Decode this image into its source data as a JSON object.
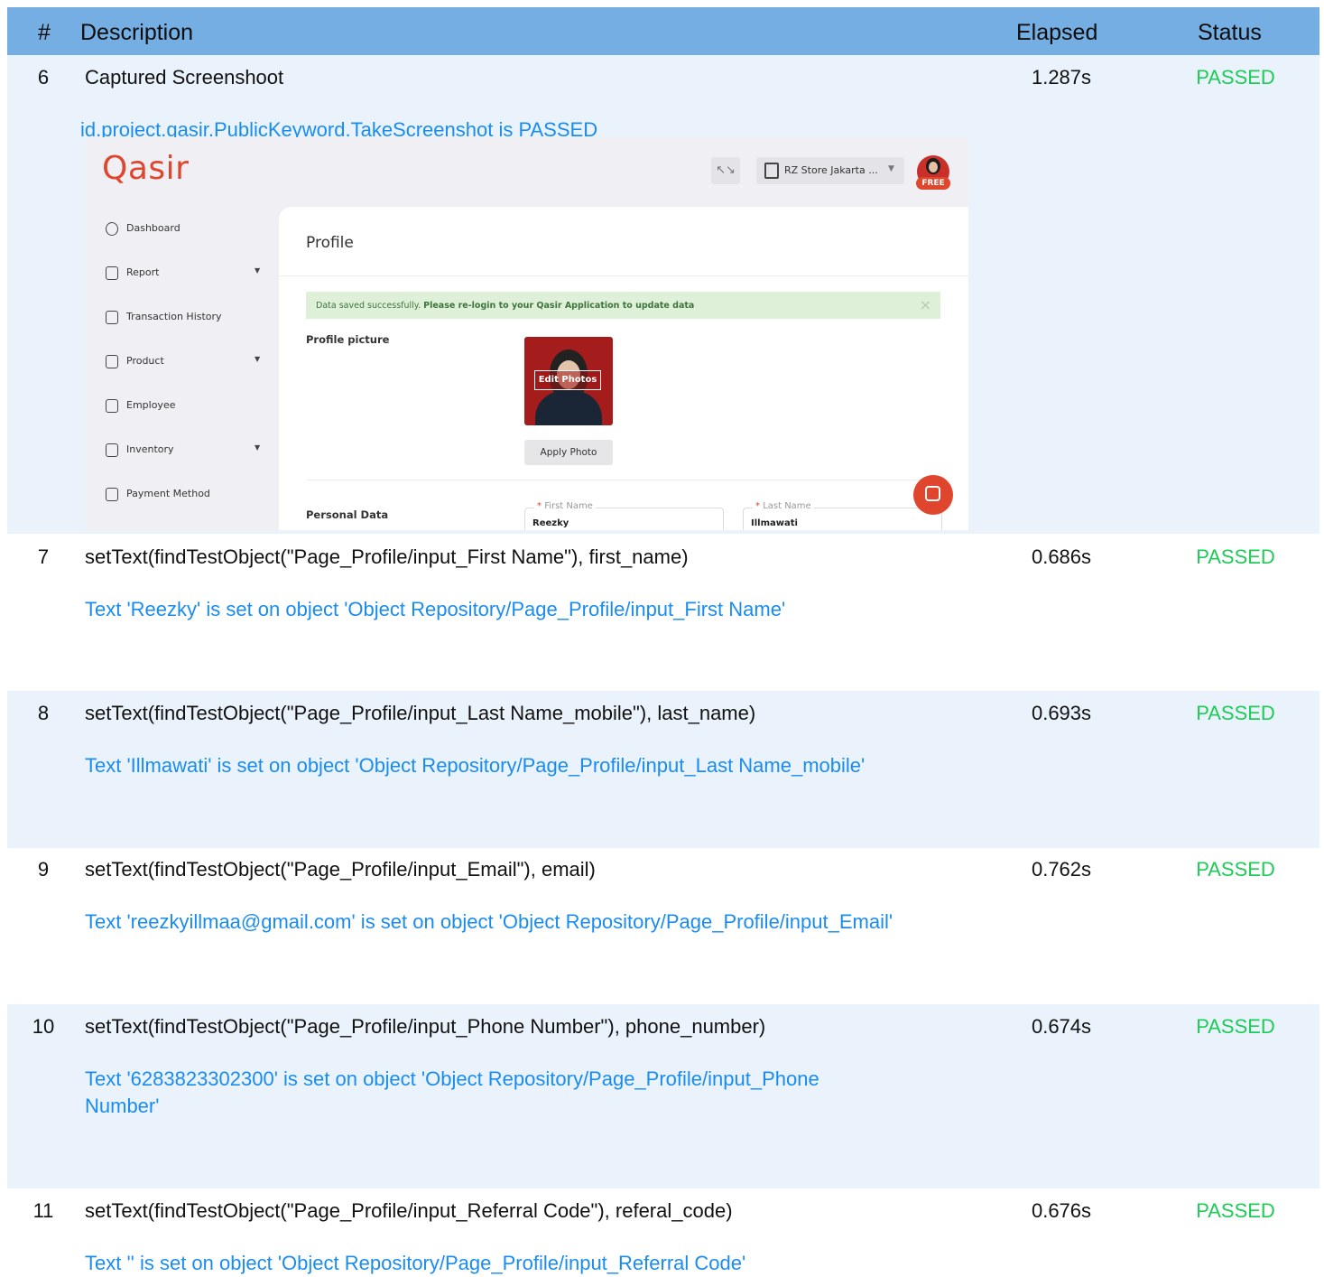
{
  "table": {
    "headers": {
      "num": "#",
      "description": "Description",
      "elapsed": "Elapsed",
      "status": "Status"
    },
    "status_color": "#1fcb58",
    "log_color": "#1a8cf0",
    "rows": [
      {
        "num": "6",
        "description": "Captured Screenshoot",
        "elapsed": "1.287s",
        "status": "PASSED",
        "log": "id.project.qasir.PublicKeyword.TakeScreenshot is PASSED"
      },
      {
        "num": "7",
        "description": "setText(findTestObject(\"Page_Profile/input_First Name\"), first_name)",
        "elapsed": "0.686s",
        "status": "PASSED",
        "log": "Text 'Reezky' is set on object 'Object Repository/Page_Profile/input_First Name'"
      },
      {
        "num": "8",
        "description": "setText(findTestObject(\"Page_Profile/input_Last Name_mobile\"), last_name)",
        "elapsed": "0.693s",
        "status": "PASSED",
        "log": "Text 'Illmawati' is set on object 'Object Repository/Page_Profile/input_Last Name_mobile'"
      },
      {
        "num": "9",
        "description": "setText(findTestObject(\"Page_Profile/input_Email\"), email)",
        "elapsed": "0.762s",
        "status": "PASSED",
        "log": "Text 'reezkyillmaa@gmail.com' is set on object 'Object Repository/Page_Profile/input_Email'"
      },
      {
        "num": "10",
        "description": "setText(findTestObject(\"Page_Profile/input_Phone Number\"), phone_number)",
        "elapsed": "0.674s",
        "status": "PASSED",
        "log": "Text '6283823302300' is set on object 'Object Repository/Page_Profile/input_Phone Number'"
      },
      {
        "num": "11",
        "description": "setText(findTestObject(\"Page_Profile/input_Referral Code\"), referal_code)",
        "elapsed": "0.676s",
        "status": "PASSED",
        "log": "Text '' is set on object 'Object Repository/Page_Profile/input_Referral Code'"
      }
    ]
  },
  "screenshot": {
    "logo": "Qasir",
    "expand_icon": "↖↘",
    "store": "RZ Store Jakarta ...",
    "avatar_badge": "FREE",
    "nav": [
      {
        "label": "Dashboard",
        "icon": "dashboard-icon",
        "has_arrow": false
      },
      {
        "label": "Report",
        "icon": "report-icon",
        "has_arrow": true
      },
      {
        "label": "Transaction History",
        "icon": "transaction-history-icon",
        "has_arrow": false
      },
      {
        "label": "Product",
        "icon": "product-icon",
        "has_arrow": true
      },
      {
        "label": "Employee",
        "icon": "employee-icon",
        "has_arrow": false
      },
      {
        "label": "Inventory",
        "icon": "inventory-icon",
        "has_arrow": true
      },
      {
        "label": "Payment Method",
        "icon": "payment-method-icon",
        "has_arrow": false
      }
    ],
    "page_title": "Profile",
    "alert": {
      "normal": "Data saved successfully.",
      "bold": "Please re-login to your Qasir Application to update data",
      "close": "×"
    },
    "profile_picture_label": "Profile picture",
    "edit_photos": "Edit Photos",
    "apply_photo": "Apply Photo",
    "personal_data_label": "Personal Data",
    "first_name": {
      "label": "First Name",
      "value": "Reezky"
    },
    "last_name": {
      "label": "Last Name",
      "value": "Illmawati"
    },
    "required_mark": "*",
    "brand_color": "#e0452d"
  }
}
